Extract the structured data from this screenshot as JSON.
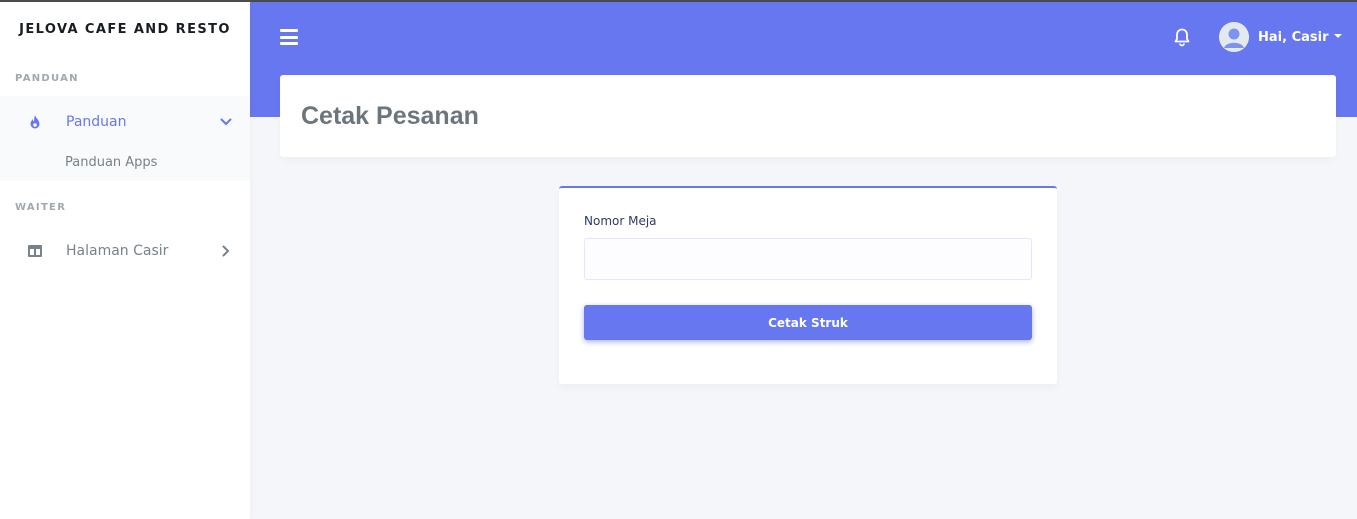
{
  "brand": "JELOVA CAFE AND RESTO",
  "sidebar": {
    "sections": [
      {
        "header": "PANDUAN",
        "item": {
          "label": "Panduan",
          "icon": "fire-icon",
          "active": true,
          "sub_items": [
            {
              "label": "Panduan Apps"
            }
          ]
        }
      },
      {
        "header": "WAITER",
        "item": {
          "label": "Halaman Casir",
          "icon": "columns-icon",
          "active": false
        }
      }
    ]
  },
  "navbar": {
    "user_greeting": "Hai, Casir",
    "accent_color": "#6777ef"
  },
  "page": {
    "title": "Cetak Pesanan"
  },
  "form": {
    "table_number_label": "Nomor Meja",
    "table_number_value": "",
    "submit_label": "Cetak Struk"
  }
}
